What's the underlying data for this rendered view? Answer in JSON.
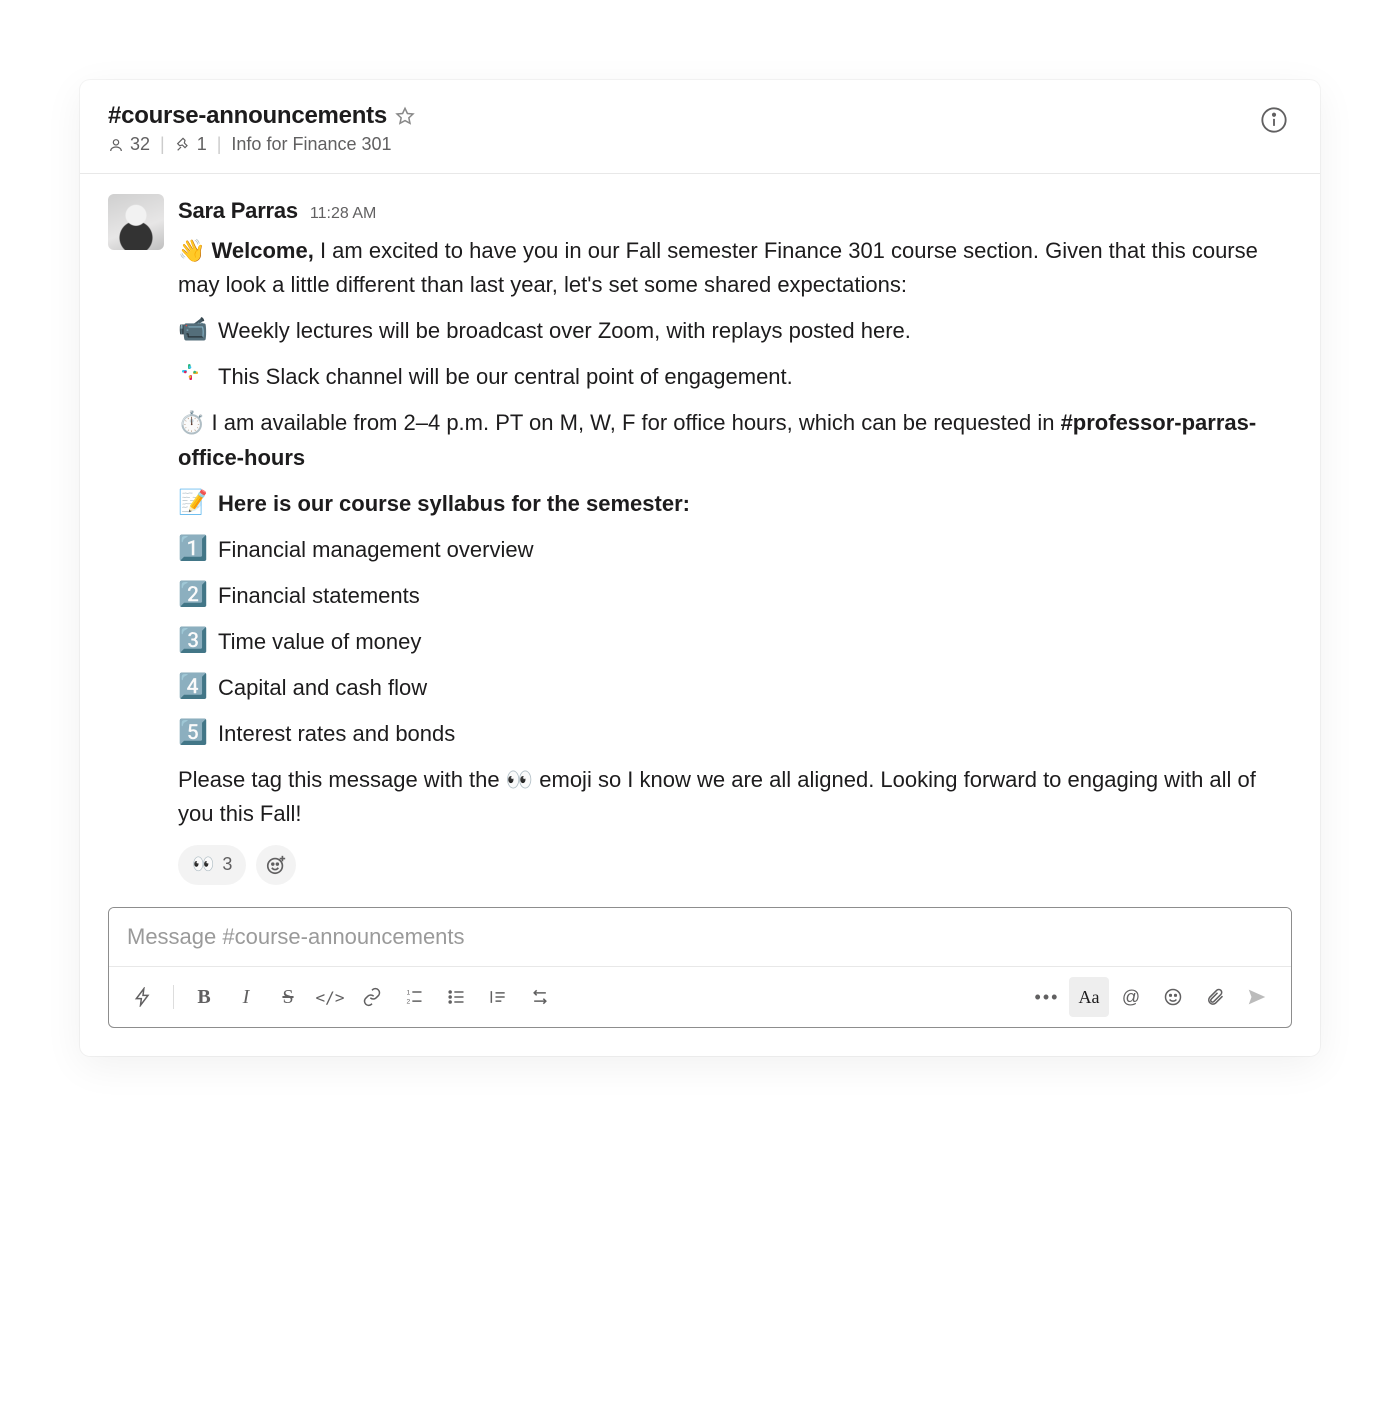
{
  "header": {
    "channel_name": "#course-announcements",
    "member_count": "32",
    "pin_count": "1",
    "topic": "Info for Finance 301"
  },
  "message": {
    "author": "Sara Parras",
    "timestamp": "11:28 AM",
    "intro_emoji": "👋",
    "intro_bold": "Welcome,",
    "intro_rest": " I am excited to have you in our Fall semester Finance 301 course section. Given that this course may look a little different than last year, let's set some shared expectations:",
    "bullets": [
      {
        "emoji": "📹",
        "text": "Weekly lectures will be broadcast over Zoom, with replays posted here."
      },
      {
        "emoji": "slack",
        "text": "This Slack channel will be our central point of engagement."
      }
    ],
    "office_emoji": "⏱️",
    "office_text_before": "I am available from 2–4 p.m. PT on M, W, F for office hours, which can be requested in ",
    "office_channel": "#professor-parras-office-hours",
    "syllabus_emoji": "📝",
    "syllabus_heading": "Here is our course syllabus for the semester:",
    "syllabus": [
      {
        "emoji": "1️⃣",
        "text": "Financial management overview"
      },
      {
        "emoji": "2️⃣",
        "text": "Financial statements"
      },
      {
        "emoji": "3️⃣",
        "text": "Time value of money"
      },
      {
        "emoji": "4️⃣",
        "text": "Capital and cash flow"
      },
      {
        "emoji": "5️⃣",
        "text": "Interest rates and bonds"
      }
    ],
    "closing_before": "Please tag this message with the ",
    "closing_emoji": "👀",
    "closing_after": " emoji so I know we are all aligned. Looking forward to engaging with all of you this Fall!"
  },
  "reactions": {
    "eyes_emoji": "👀",
    "eyes_count": "3"
  },
  "composer": {
    "placeholder": "Message #course-announcements"
  },
  "toolbar": {
    "bold": "B",
    "italic": "I",
    "strike": "S",
    "code": "</>",
    "aa": "Aa",
    "at": "@",
    "more": "•••"
  }
}
